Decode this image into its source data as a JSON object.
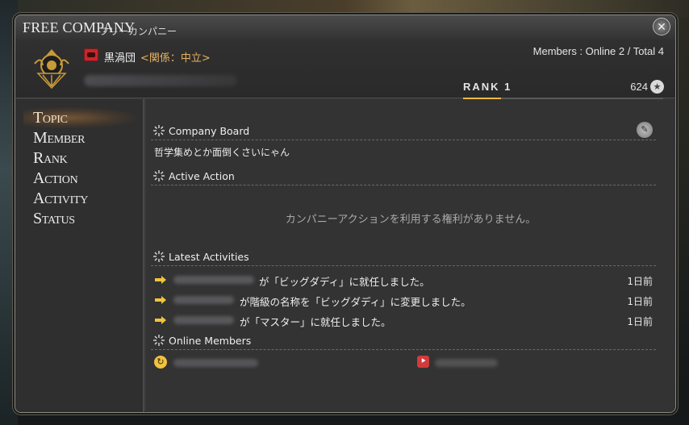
{
  "window": {
    "title": "FREE COMPANY",
    "subtitle": "フリーカンパニー",
    "close_icon": "close-icon"
  },
  "header": {
    "fc_name": "黒渦団",
    "fc_relation": "<関係：中立>",
    "members_text": "Members : Online 2 / Total 4",
    "rank_label": "RANK  1",
    "rank_points": "624",
    "rank_progress_percent": 19,
    "accent_color": "#e7b25f"
  },
  "sidebar": {
    "items": [
      {
        "label": "Topic",
        "active": true
      },
      {
        "label": "Member",
        "active": false
      },
      {
        "label": "Rank",
        "active": false
      },
      {
        "label": "Action",
        "active": false
      },
      {
        "label": "Activity",
        "active": false
      },
      {
        "label": "Status",
        "active": false
      }
    ]
  },
  "content": {
    "company_board": {
      "title": "Company Board",
      "text": "哲学集めとか面倒くさいにゃん",
      "edit_icon": "pencil-icon"
    },
    "active_action": {
      "title": "Active Action",
      "empty_text": "カンパニーアクションを利用する権利がありません。"
    },
    "latest_activities": {
      "title": "Latest Activities",
      "rows": [
        {
          "text": "が「ビッグダディ」に就任しました。",
          "time": "1日前"
        },
        {
          "text": "が階級の名称を「ビッグダディ」に変更しました。",
          "time": "1日前"
        },
        {
          "text": "が「マスター」に就任しました。",
          "time": "1日前"
        }
      ]
    },
    "online_members": {
      "title": "Online Members"
    }
  }
}
